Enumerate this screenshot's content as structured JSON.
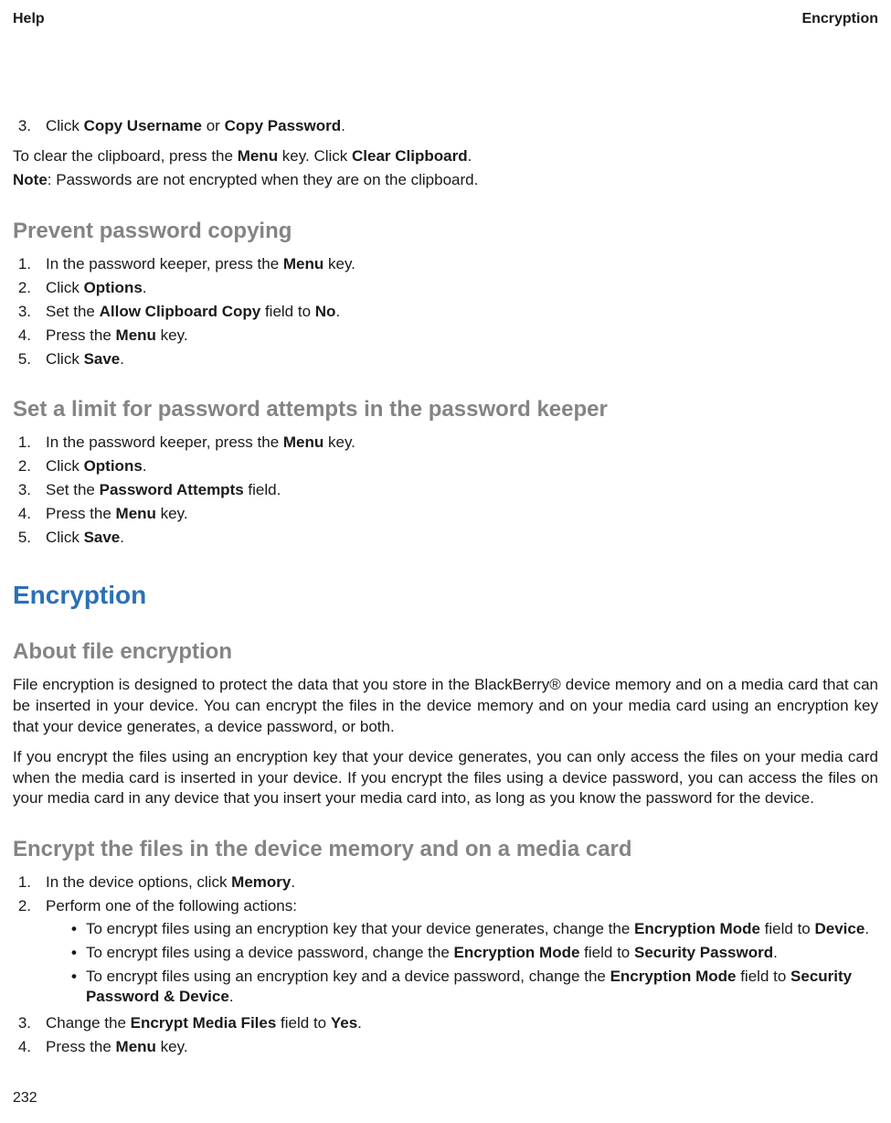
{
  "header": {
    "left": "Help",
    "right": "Encryption"
  },
  "section0": {
    "step3_prefix": "Click ",
    "step3_b1": "Copy Username",
    "step3_mid": " or ",
    "step3_b2": "Copy Password",
    "step3_suffix": "."
  },
  "clipboard": {
    "p1_a": "To clear the clipboard, press the ",
    "p1_b1": "Menu",
    "p1_b": " key. Click ",
    "p1_b2": "Clear Clipboard",
    "p1_c": ".",
    "note_label": "Note",
    "note_text": ":  Passwords are not encrypted when they are on the clipboard."
  },
  "prevent": {
    "title": "Prevent password copying",
    "s1_a": "In the password keeper, press the ",
    "s1_b": "Menu",
    "s1_c": " key.",
    "s2_a": "Click ",
    "s2_b": "Options",
    "s2_c": ".",
    "s3_a": "Set the ",
    "s3_b": "Allow Clipboard Copy",
    "s3_c": " field to ",
    "s3_d": "No",
    "s3_e": ".",
    "s4_a": "Press the ",
    "s4_b": "Menu",
    "s4_c": " key.",
    "s5_a": "Click ",
    "s5_b": "Save",
    "s5_c": "."
  },
  "limit": {
    "title": "Set a limit for password attempts in the password keeper",
    "s1_a": "In the password keeper, press the ",
    "s1_b": "Menu",
    "s1_c": " key.",
    "s2_a": "Click ",
    "s2_b": "Options",
    "s2_c": ".",
    "s3_a": "Set the ",
    "s3_b": "Password Attempts",
    "s3_c": " field.",
    "s4_a": "Press the ",
    "s4_b": "Menu",
    "s4_c": " key.",
    "s5_a": "Click ",
    "s5_b": "Save",
    "s5_c": "."
  },
  "encryption": {
    "title": "Encryption",
    "about_title": "About file encryption",
    "p1": "File encryption is designed to protect the data that you store in the BlackBerry® device memory and on a media card that can be inserted in your device. You can encrypt the files in the device memory and on your media card using an encryption key that your device generates, a device password, or both.",
    "p2": "If you encrypt the files using an encryption key that your device generates, you can only access the files on your media card when the media card is inserted in your device. If you encrypt the files using a device password, you can access the files on your media card in any device that you insert your media card into, as long as you know the password for the device."
  },
  "encrypt_files": {
    "title": "Encrypt the files in the device memory and on a media card",
    "s1_a": "In the device options, click ",
    "s1_b": "Memory",
    "s1_c": ".",
    "s2": "Perform one of the following actions:",
    "b1_a": "To encrypt files using an encryption key that your device generates, change the ",
    "b1_b": "Encryption Mode",
    "b1_c": " field to ",
    "b1_d": "Device",
    "b1_e": ".",
    "b2_a": "To encrypt files using a device password, change the ",
    "b2_b": "Encryption Mode",
    "b2_c": " field to ",
    "b2_d": "Security Password",
    "b2_e": ".",
    "b3_a": "To encrypt files using an encryption key and a device password, change the ",
    "b3_b": "Encryption Mode",
    "b3_c": " field to ",
    "b3_d": "Security Password & Device",
    "b3_e": ".",
    "s3_a": "Change the ",
    "s3_b": "Encrypt Media Files",
    "s3_c": " field to ",
    "s3_d": "Yes",
    "s3_e": ".",
    "s4_a": "Press the ",
    "s4_b": "Menu",
    "s4_c": " key."
  },
  "page_number": "232"
}
